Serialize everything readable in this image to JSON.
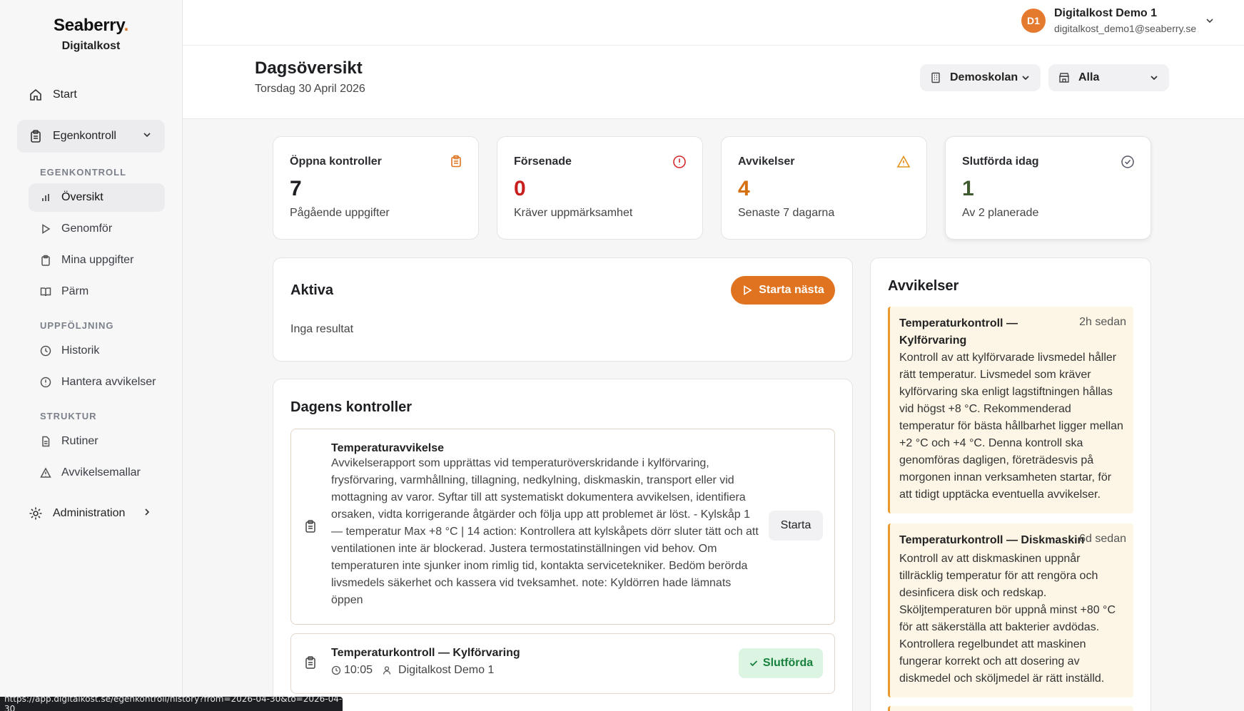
{
  "brand": {
    "name": "Seaberry",
    "dot": ".",
    "org": "Digitalkost"
  },
  "sidebar": {
    "start": "Start",
    "egenkontroll": "Egenkontroll",
    "sections": [
      {
        "title": "EGENKONTROLL",
        "items": [
          "Översikt",
          "Genomför",
          "Mina uppgifter",
          "Pärm"
        ]
      },
      {
        "title": "UPPFÖLJNING",
        "items": [
          "Historik",
          "Hantera avvikelser"
        ]
      },
      {
        "title": "STRUKTUR",
        "items": [
          "Rutiner",
          "Avvikelsemallar"
        ]
      }
    ],
    "administration": "Administration"
  },
  "user": {
    "initials": "D1",
    "name": "Digitalkost Demo 1",
    "email": "digitalkost_demo1@seaberry.se"
  },
  "header": {
    "title": "Dagsöversikt",
    "date": "Torsdag 30 April 2026",
    "school_select": "Demoskolan",
    "unit_select": "Alla"
  },
  "stats": [
    {
      "label": "Öppna kontroller",
      "value": "7",
      "desc": "Pågående uppgifter",
      "color": "#1c1e22",
      "icon": "clipboard-icon"
    },
    {
      "label": "Försenade",
      "value": "0",
      "desc": "Kräver uppmärksamhet",
      "color": "#c81e1e",
      "icon": "alert-circle-icon"
    },
    {
      "label": "Avvikelser",
      "value": "4",
      "desc": "Senaste 7 dagarna",
      "color": "#d4700f",
      "icon": "warning-triangle-icon"
    },
    {
      "label": "Slutförda idag",
      "value": "1",
      "desc": "Av 2 planerade",
      "color": "#3f5a2e",
      "icon": "check-circle-icon"
    }
  ],
  "aktiva": {
    "title": "Aktiva",
    "button": "Starta nästa",
    "empty": "Inga resultat"
  },
  "dagens": {
    "title": "Dagens kontroller",
    "tasks": [
      {
        "title": "Temperaturavvikelse",
        "desc": "Avvikelserapport som upprättas vid temperaturöverskridande i kylförvaring, frysförvaring, varmhållning, tillagning, nedkylning, diskmaskin, transport eller vid mottagning av varor. Syftar till att systematiskt dokumentera avvikelsen, identifiera orsaken, vidta korrigerande åtgärder och följa upp att problemet är löst. - Kylskåp 1 — temperatur Max +8 °C | 14 action: Kontrollera att kylskåpets dörr sluter tätt och att ventilationen inte är blockerad. Justera termostatinställningen vid behov. Om temperaturen inte sjunker inom rimlig tid, kontakta servicetekniker. Bedöm berörda livsmedels säkerhet och kassera vid tveksamhet. note: Kyldörren hade lämnats öppen",
        "action": "Starta"
      },
      {
        "title": "Temperaturkontroll — Kylförvaring",
        "time": "10:05",
        "user": "Digitalkost Demo 1",
        "status": "Slutförda"
      }
    ]
  },
  "avvikelser": {
    "title": "Avvikelser",
    "items": [
      {
        "title": "Temperaturkontroll — Kylförvaring",
        "time": "2h sedan",
        "text": "Kontroll av att kylförvarade livsmedel håller rätt temperatur. Livsmedel som kräver kylförvaring ska enligt lagstiftningen hållas vid högst +8 °C. Rekommenderad temperatur för bästa hållbarhet ligger mellan +2 °C och +4 °C. Denna kontroll ska genomföras dagligen, företrädesvis på morgonen innan verksamheten startar, för att tidigt upptäcka eventuella avvikelser."
      },
      {
        "title": "Temperaturkontroll — Diskmaskin",
        "time": "6d sedan",
        "text": "Kontroll av att diskmaskinen uppnår tillräcklig temperatur för att rengöra och desinficera disk och redskap. Sköljtemperaturen bör uppnå minst +80 °C för att säkerställa att bakterier avdödas. Kontrollera regelbundet att maskinen fungerar korrekt och att dosering av diskmedel och sköljmedel är rätt inställd."
      }
    ]
  },
  "statusbar": {
    "url": "https://app.digitalkost.se/egenkontroll/history?from=2026-04-30&to=2026-04-30"
  }
}
